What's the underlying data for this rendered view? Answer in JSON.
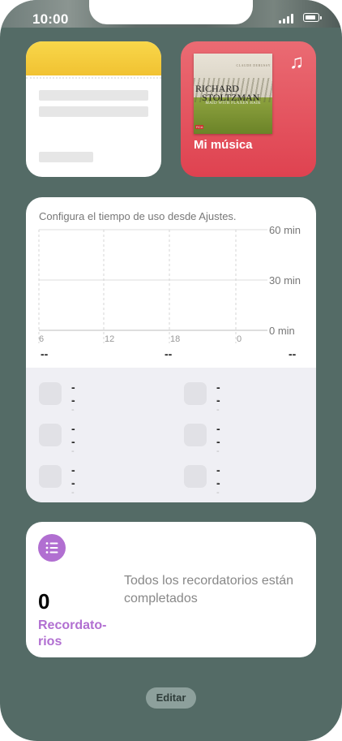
{
  "status_bar": {
    "time": "10:00"
  },
  "notes_widget": {},
  "music_widget": {
    "label": "Mi música",
    "album": {
      "top_text": "CLAUDE DEBUSSY",
      "artist_line1": "RICHARD",
      "artist_line2": "STOLTZMAN",
      "subtitle": "MAID WITH FLAXEN HAIR",
      "label_mark": "RCA"
    }
  },
  "screen_time": {
    "message": "Configura el tiempo de uso desde Ajustes.",
    "y_labels": [
      "60 min",
      "30 min",
      "0 min"
    ],
    "x_labels": [
      "6",
      "12",
      "18",
      "0"
    ],
    "summary": [
      "--",
      "--",
      "--"
    ],
    "items": [
      {
        "title": "--",
        "subtitle": "--"
      },
      {
        "title": "--",
        "subtitle": "--"
      },
      {
        "title": "--",
        "subtitle": "--"
      },
      {
        "title": "--",
        "subtitle": "--"
      },
      {
        "title": "--",
        "subtitle": "--"
      },
      {
        "title": "--",
        "subtitle": "--"
      }
    ]
  },
  "reminders": {
    "count": "0",
    "label": "Recordato-rios",
    "message": "Todos los recordatorios están completados",
    "accent_color": "#b16fd1"
  },
  "edit_button": {
    "label": "Editar"
  }
}
